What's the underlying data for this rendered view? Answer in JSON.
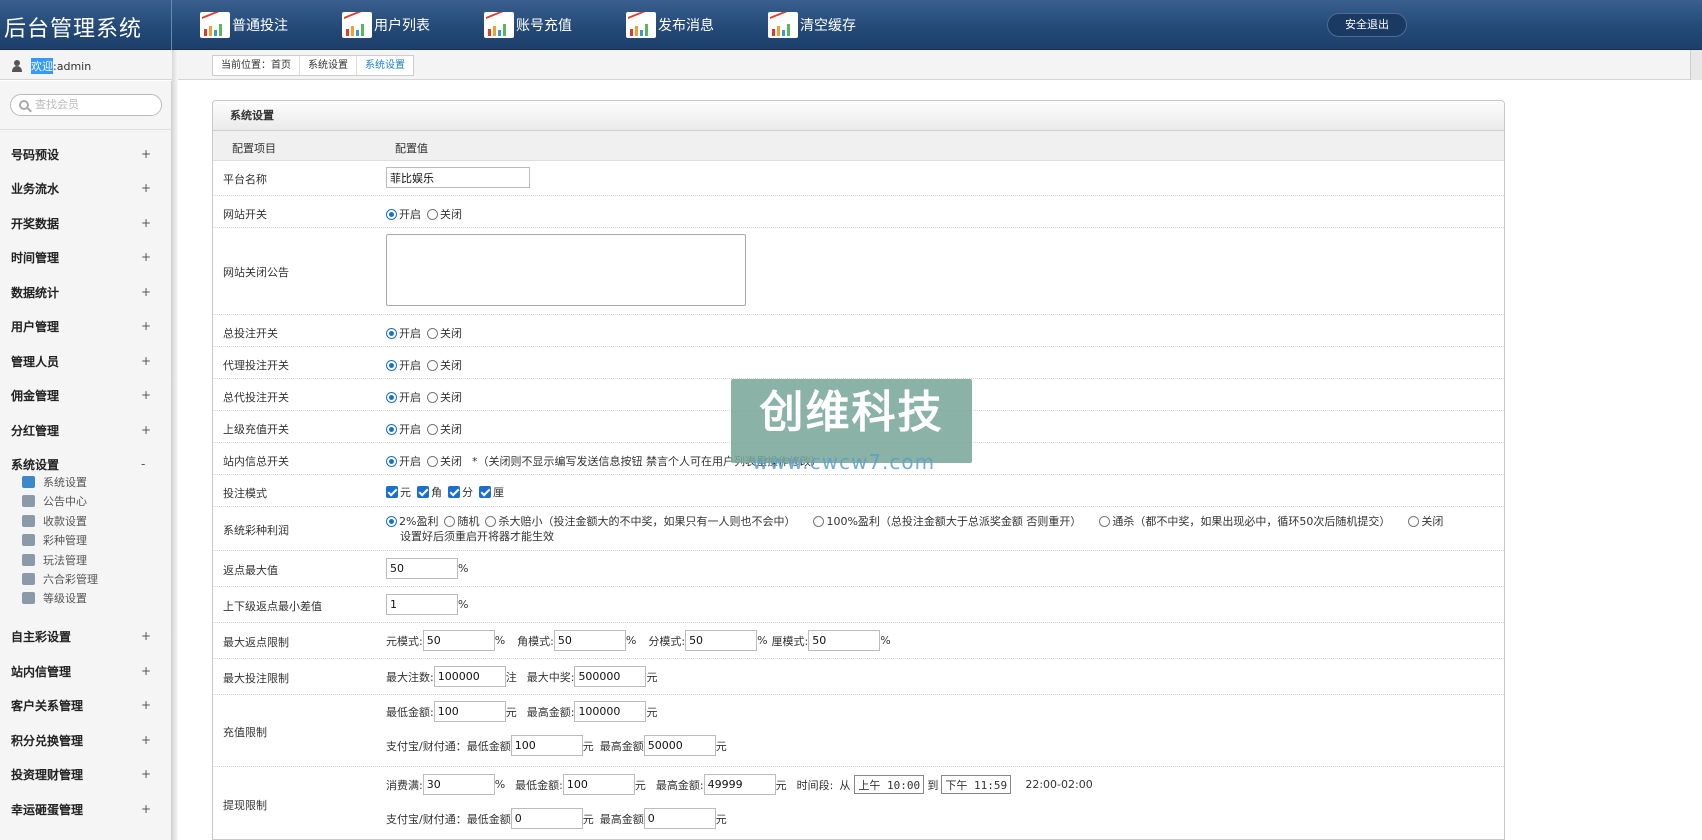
{
  "app": {
    "title": "后台管理系统"
  },
  "topnav": [
    {
      "label": "普通投注"
    },
    {
      "label": "用户列表"
    },
    {
      "label": "账号充值"
    },
    {
      "label": "发布消息"
    },
    {
      "label": "清空缓存"
    }
  ],
  "logout_label": "安全退出",
  "welcome": {
    "prefix": "欢迎",
    "sep": ": ",
    "user": "admin"
  },
  "breadcrumb": [
    "当前位置：首页",
    "系统设置",
    "系统设置"
  ],
  "search": {
    "placeholder": "查找会员"
  },
  "sidebar": {
    "menus": [
      {
        "label": "号码预设",
        "toggle": "+"
      },
      {
        "label": "业务流水",
        "toggle": "+"
      },
      {
        "label": "开奖数据",
        "toggle": "+"
      },
      {
        "label": "时间管理",
        "toggle": "+"
      },
      {
        "label": "数据统计",
        "toggle": "+"
      },
      {
        "label": "用户管理",
        "toggle": "+"
      },
      {
        "label": "管理人员",
        "toggle": "+"
      },
      {
        "label": "佣金管理",
        "toggle": "+"
      },
      {
        "label": "分红管理",
        "toggle": "+"
      },
      {
        "label": "系统设置",
        "toggle": "-"
      }
    ],
    "submenu": [
      {
        "label": "系统设置",
        "icon": "wrench-icon"
      },
      {
        "label": "公告中心",
        "icon": "notice-icon"
      },
      {
        "label": "收款设置",
        "icon": "payment-icon"
      },
      {
        "label": "彩种管理",
        "icon": "lottery-icon"
      },
      {
        "label": "玩法管理",
        "icon": "gamepad-icon"
      },
      {
        "label": "六合彩管理",
        "icon": "gamepad-icon"
      },
      {
        "label": "等级设置",
        "icon": "level-icon"
      }
    ],
    "menus_after": [
      {
        "label": "自主彩设置",
        "toggle": "+"
      },
      {
        "label": "站内信管理",
        "toggle": "+"
      },
      {
        "label": "客户关系管理",
        "toggle": "+"
      },
      {
        "label": "积分兑换管理",
        "toggle": "+"
      },
      {
        "label": "投资理财管理",
        "toggle": "+"
      },
      {
        "label": "幸运砸蛋管理",
        "toggle": "+"
      }
    ]
  },
  "panel": {
    "title": "系统设置",
    "col_item": "配置项目",
    "col_value": "配置值"
  },
  "form": {
    "platform_name": {
      "label": "平台名称",
      "value": "菲比娱乐"
    },
    "site_switch": {
      "label": "网站开关",
      "on": "开启",
      "off": "关闭"
    },
    "site_close_notice": {
      "label": "网站关闭公告",
      "value": ""
    },
    "bet_switch": {
      "label": "总投注开关",
      "on": "开启",
      "off": "关闭"
    },
    "agent_bet_switch": {
      "label": "代理投注开关",
      "on": "开启",
      "off": "关闭"
    },
    "general_agent_bet_switch": {
      "label": "总代投注开关",
      "on": "开启",
      "off": "关闭"
    },
    "upper_recharge_switch": {
      "label": "上级充值开关",
      "on": "开启",
      "off": "关闭"
    },
    "internal_msg_switch": {
      "label": "站内信总开关",
      "on": "开启",
      "off": "关闭",
      "note": "*（关闭则不显示编写发送信息按钮 禁言个人可在用户列表里操作修改）"
    },
    "bet_mode": {
      "label": "投注模式",
      "options": [
        "元",
        "角",
        "分",
        "厘"
      ]
    },
    "profit_mode": {
      "label": "系统彩种利润",
      "options": [
        "2%盈利",
        "随机",
        "杀大赔小（投注金额大的不中奖，如果只有一人则也不会中）",
        "100%盈利（总投注金额大于总派奖金额 否则重开）",
        "通杀（都不中奖，如果出现必中，循环50次后随机提交）",
        "关闭"
      ],
      "note": "设置好后须重启开将器才能生效"
    },
    "max_rebate": {
      "label": "返点最大值",
      "value": "50",
      "unit": "%"
    },
    "min_rebate_diff": {
      "label": "上下级返点最小差值",
      "value": "1",
      "unit": "%"
    },
    "max_rebate_limit": {
      "label": "最大返点限制",
      "items": [
        {
          "name": "元模式:",
          "value": "50",
          "unit": "%"
        },
        {
          "name": "角模式:",
          "value": "50",
          "unit": "%"
        },
        {
          "name": "分模式:",
          "value": "50",
          "unit": "%"
        },
        {
          "name": "厘模式:",
          "value": "50",
          "unit": "%"
        }
      ]
    },
    "max_bet_limit": {
      "label": "最大投注限制",
      "count_name": "最大注数:",
      "count_value": "100000",
      "count_unit": "注",
      "win_name": "最大中奖:",
      "win_value": "500000",
      "win_unit": "元"
    },
    "recharge_limit": {
      "label": "充值限制",
      "min_name": "最低金额:",
      "min_value": "100",
      "min_unit": "元",
      "max_name": "最高金额:",
      "max_value": "100000",
      "max_unit": "元",
      "alipay_prefix": "支付宝/财付通：",
      "alipay_min_name": "最低金额",
      "alipay_min_value": "100",
      "alipay_min_unit": "元",
      "alipay_max_name": "最高金额",
      "alipay_max_value": "50000",
      "alipay_max_unit": "元"
    },
    "withdraw_limit": {
      "label": "提现限制",
      "consume_name": "消费满:",
      "consume_value": "30",
      "consume_unit": "%",
      "min_name": "最低金额:",
      "min_value": "100",
      "min_unit": "元",
      "max_name": "最高金额:",
      "max_value": "49999",
      "max_unit": "元",
      "period_name": "时间段:",
      "from": "从",
      "start_time": "上午 10:00",
      "to": "到",
      "end_time": "下午 11:59",
      "period_text": "22:00-02:00",
      "alipay_prefix": "支付宝/财付通：",
      "alipay_min_name": "最低金额",
      "alipay_min_value": "0",
      "alipay_min_unit": "元",
      "alipay_max_name": "最高金额",
      "alipay_max_value": "0",
      "alipay_max_unit": "元"
    }
  },
  "watermark": {
    "text": "创维科技",
    "url": "www.cwcw7.com"
  },
  "colors": {
    "header": "#244a78",
    "accent": "#1a6fd0",
    "breadcrumb_active": "#1a7fc9"
  }
}
